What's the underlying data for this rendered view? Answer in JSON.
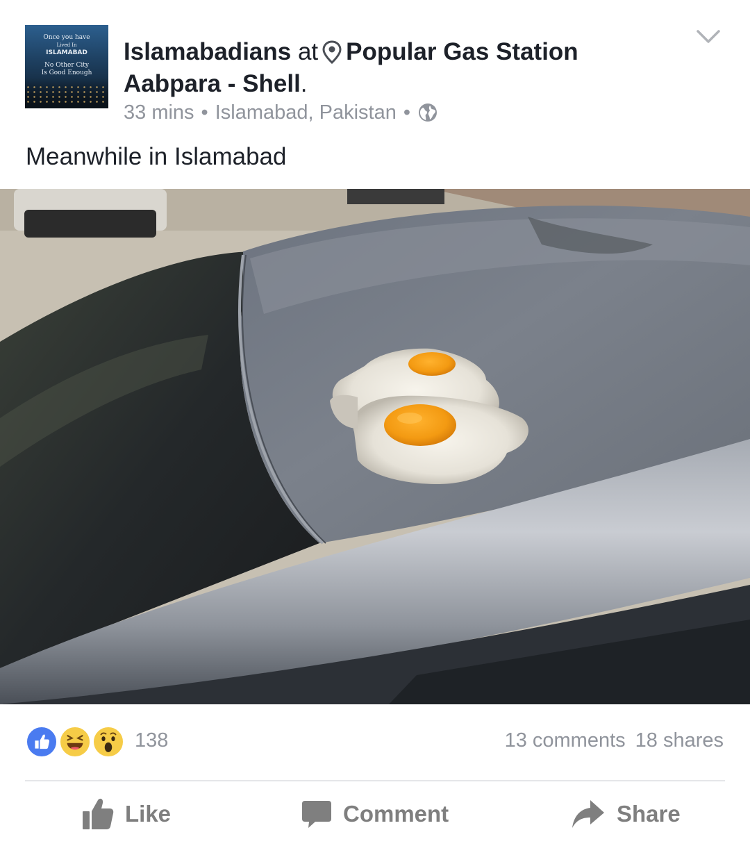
{
  "post": {
    "page_name": "Islamabadians",
    "at_word": "at",
    "place_line1": "Popular Gas Station",
    "place_line2": "Aabpara - Shell",
    "place_end": ".",
    "time": "33 mins",
    "location": "Islamabad, Pakistan",
    "privacy_icon": "globe-icon",
    "text": "Meanwhile in Islamabad",
    "avatar": {
      "line1": "Once you have",
      "line2": "Lived In",
      "line3": "ISLAMABAD",
      "line4": "No Other City",
      "line5": "Is Good Enough"
    }
  },
  "reactions": {
    "icons": [
      "like-reaction-icon",
      "haha-reaction-icon",
      "wow-reaction-icon"
    ],
    "count": "138"
  },
  "stats": {
    "comments": "13 comments",
    "shares": "18 shares"
  },
  "actions": {
    "like": "Like",
    "comment": "Comment",
    "share": "Share"
  },
  "colors": {
    "facebook_blue": "#4a7bf0",
    "reaction_yellow": "#f6cc47",
    "muted_text": "#90949c",
    "action_gray": "#7f7f7f"
  }
}
